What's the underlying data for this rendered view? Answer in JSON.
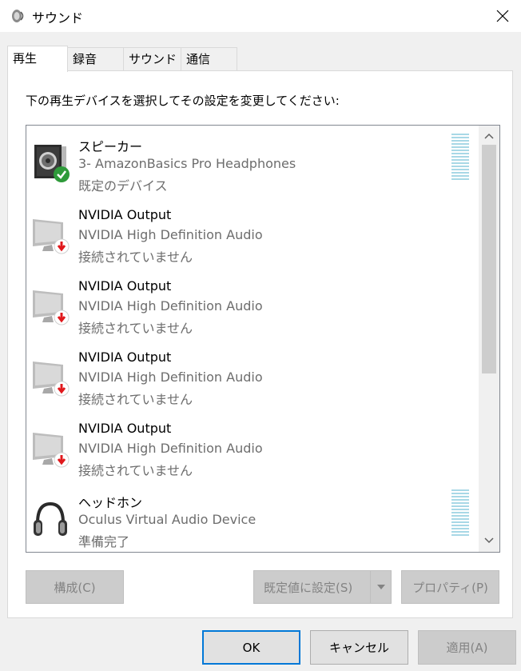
{
  "window": {
    "title": "サウンド",
    "close_glyph": "✕"
  },
  "tabs": [
    {
      "label": "再生",
      "active": true
    },
    {
      "label": "録音",
      "active": false
    },
    {
      "label": "サウンド",
      "active": false
    },
    {
      "label": "通信",
      "active": false
    }
  ],
  "instruction": "下の再生デバイスを選択してその設定を変更してください:",
  "devices": [
    {
      "name": "スピーカー",
      "description": "3- AmazonBasics Pro Headphones",
      "status": "既定のデバイス",
      "icon": "speaker-icon",
      "badge": "default-check-badge"
    },
    {
      "name": "NVIDIA Output",
      "description": "NVIDIA High Definition Audio",
      "status": "接続されていません",
      "icon": "monitor-icon",
      "badge": "disconnected-badge"
    },
    {
      "name": "NVIDIA Output",
      "description": "NVIDIA High Definition Audio",
      "status": "接続されていません",
      "icon": "monitor-icon",
      "badge": "disconnected-badge"
    },
    {
      "name": "NVIDIA Output",
      "description": "NVIDIA High Definition Audio",
      "status": "接続されていません",
      "icon": "monitor-icon",
      "badge": "disconnected-badge"
    },
    {
      "name": "NVIDIA Output",
      "description": "NVIDIA High Definition Audio",
      "status": "接続されていません",
      "icon": "monitor-icon",
      "badge": "disconnected-badge"
    },
    {
      "name": "ヘッドホン",
      "description": "Oculus Virtual Audio Device",
      "status": "準備完了",
      "icon": "headphones-icon",
      "badge": ""
    }
  ],
  "buttons": {
    "configure": "構成(C)",
    "set_default": "既定値に設定(S)",
    "properties": "プロパティ(P)",
    "ok": "OK",
    "cancel": "キャンセル",
    "apply": "適用(A)"
  },
  "colors": {
    "accent": "#0078d7",
    "meter": "#a8d8e6",
    "check_green": "#2e9a3a",
    "disconnect_red": "#e0181c"
  }
}
